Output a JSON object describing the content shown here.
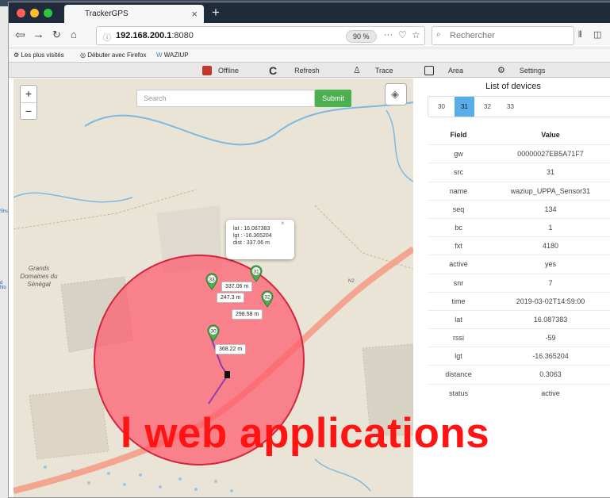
{
  "desktop": {
    "labels": [
      "Shut",
      "d No"
    ]
  },
  "browser": {
    "tab_title": "TrackerGPS",
    "url_host": "192.168.200.1",
    "url_port": ":8080",
    "zoom": "90 %",
    "search_placeholder": "Rechercher",
    "bookmarks": [
      "Les plus visités",
      "Débuter avec Firefox",
      "WAZIUP"
    ],
    "colors": {
      "titlebar": "#1f2a3a",
      "close": "#ff5f57",
      "minimize": "#febc2e",
      "maximize": "#28c840"
    }
  },
  "toolbar": {
    "buttons": [
      {
        "label": "Offline",
        "icon": "power-icon"
      },
      {
        "label": "Refresh",
        "icon": "refresh-icon"
      },
      {
        "label": "Trace",
        "icon": "person-icon"
      },
      {
        "label": "Area",
        "icon": "square-icon"
      },
      {
        "label": "Settings",
        "icon": "gears-icon"
      }
    ]
  },
  "map": {
    "search_placeholder": "Search",
    "submit_label": "Submit",
    "place_label": "Grands Domaines du Sénégal",
    "road_label": "N2",
    "popup": {
      "lat": "lat : 16.087383",
      "lgt": "lgt : -16.365204",
      "dist": "dist : 337.06 m"
    },
    "markers": [
      {
        "id": "30",
        "distance": "368.22 m"
      },
      {
        "id": "31",
        "distance": "337.06 m"
      },
      {
        "id": "32",
        "distance": "298.58 m"
      },
      {
        "id": "33",
        "distance": "247.3 m"
      }
    ],
    "colors": {
      "area": "#ff5a6e",
      "area_border": "#d6243f",
      "marker": "#4caf50",
      "road": "#f3a58f",
      "water": "#7cb8e0",
      "trace": "#8e3fae"
    }
  },
  "panel": {
    "title": "List of devices",
    "tabs": [
      "30",
      "31",
      "32",
      "33"
    ],
    "active_tab": "31",
    "headers": {
      "field": "Field",
      "value": "Value"
    },
    "rows": [
      {
        "field": "gw",
        "value": "00000027EB5A71F7"
      },
      {
        "field": "src",
        "value": "31"
      },
      {
        "field": "name",
        "value": "waziup_UPPA_Sensor31"
      },
      {
        "field": "seq",
        "value": "134"
      },
      {
        "field": "bc",
        "value": "1"
      },
      {
        "field": "fxt",
        "value": "4180"
      },
      {
        "field": "active",
        "value": "yes"
      },
      {
        "field": "snr",
        "value": "7"
      },
      {
        "field": "time",
        "value": "2019-03-02T14:59:00"
      },
      {
        "field": "lat",
        "value": "16.087383"
      },
      {
        "field": "rssi",
        "value": "-59"
      },
      {
        "field": "lgt",
        "value": "-16.365204"
      },
      {
        "field": "distance",
        "value": "0.3063"
      },
      {
        "field": "status",
        "value": "active"
      }
    ]
  },
  "overlay_text": "l web applications"
}
